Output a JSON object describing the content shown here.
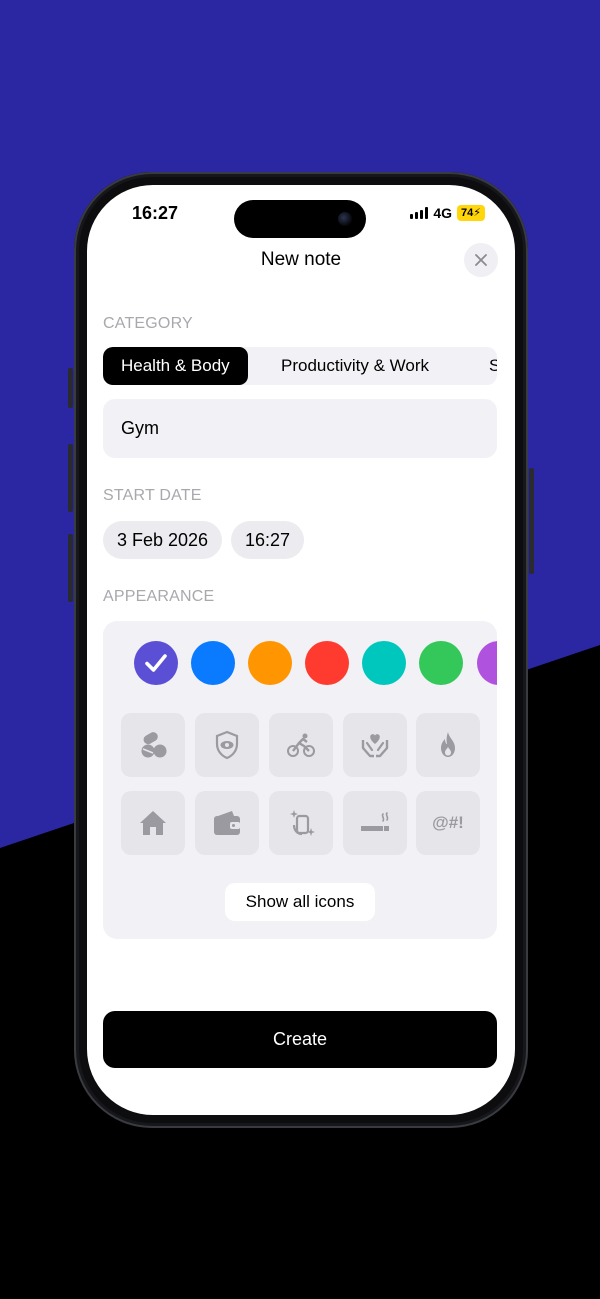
{
  "status": {
    "time": "16:27",
    "network": "4G",
    "battery": "74"
  },
  "header": {
    "title": "New note"
  },
  "category": {
    "label": "CATEGORY",
    "items": [
      {
        "label": "Health & Body",
        "active": true
      },
      {
        "label": "Productivity & Work",
        "active": false
      },
      {
        "label": "S",
        "active": false
      }
    ]
  },
  "name_field": {
    "value": "Gym"
  },
  "start_date": {
    "label": "START DATE",
    "date": "3 Feb 2026",
    "time": "16:27"
  },
  "appearance": {
    "label": "APPEARANCE",
    "colors": [
      "#5b4fd6",
      "#0a7aff",
      "#ff9500",
      "#ff3b30",
      "#00c7be",
      "#34c759",
      "#af52de"
    ],
    "selected_color_index": 0,
    "icons": [
      "pills-icon",
      "shield-eye-icon",
      "cyclist-icon",
      "hands-heart-icon",
      "flame-icon",
      "house-icon",
      "wallet-icon",
      "phone-sparkle-icon",
      "cigarette-icon",
      "symbols-icon"
    ],
    "symbols_text": "@#!",
    "show_all_label": "Show all icons"
  },
  "create_label": "Create",
  "theme": {
    "accent": "#5b4fd6",
    "bg_blue": "#2b27a2",
    "icon_gray": "#9a9aa0"
  }
}
